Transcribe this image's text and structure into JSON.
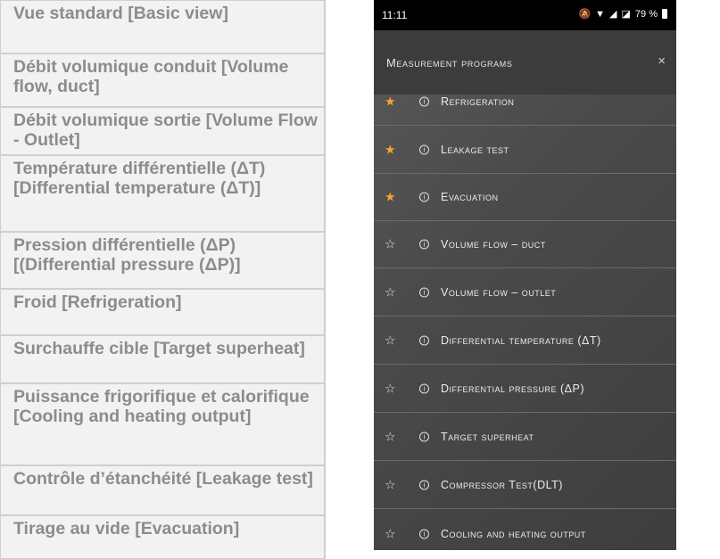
{
  "table": {
    "rows": [
      "Vue standard [Basic view]",
      "Débit volumique conduit [Volume flow, duct]",
      "Débit volumique sortie [Volume Flow - Outlet]",
      "Température différentielle (ΔT) [Differential temperature (ΔT)]",
      "Pression différentielle (ΔP) [(Differential pressure (ΔP)]",
      "Froid [Refrigeration]",
      "Surchauffe cible [Target superheat]",
      "Puissance frigorifique et calorifique [Cooling and heating output]",
      "Contrôle d’étanchéité [Leakage test]",
      "Tirage au vide [Evacuation]"
    ]
  },
  "phone": {
    "status": {
      "time": "11:11",
      "battery": "79 %"
    },
    "header": {
      "title": "Measurement programs",
      "close": "×"
    },
    "items": [
      {
        "label": "Refrigeration",
        "favorite": true
      },
      {
        "label": "Leakage test",
        "favorite": true
      },
      {
        "label": "Evacuation",
        "favorite": true
      },
      {
        "label": "Volume flow – duct",
        "favorite": false
      },
      {
        "label": "Volume flow – outlet",
        "favorite": false
      },
      {
        "label": "Differential temperature (ΔT)",
        "favorite": false
      },
      {
        "label": "Differential pressure (ΔP)",
        "favorite": false
      },
      {
        "label": "Target superheat",
        "favorite": false
      },
      {
        "label": "Compressor Test(DLT)",
        "favorite": false
      },
      {
        "label": "Cooling and heating output",
        "favorite": false
      }
    ],
    "icons": {
      "star_filled": "star-filled-icon",
      "star_outline": "star-outline-icon",
      "info": "info-icon"
    },
    "colors": {
      "favorite_star": "#f5a623",
      "background": "#4a4a4a"
    }
  }
}
